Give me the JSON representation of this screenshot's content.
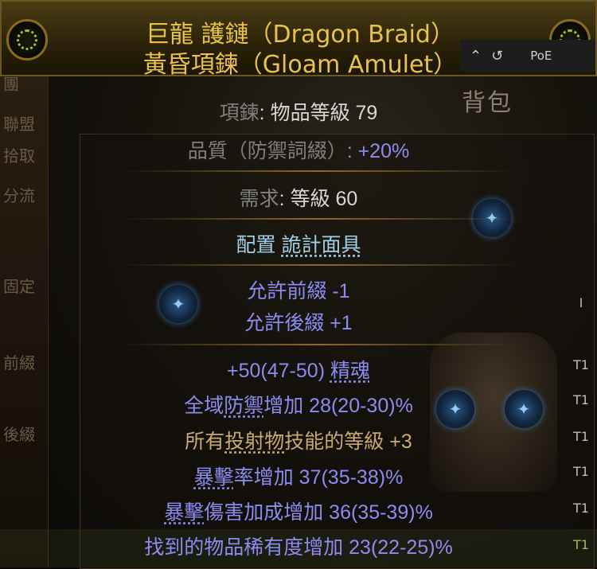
{
  "background": {
    "left_menu": [
      "團",
      "聯盟",
      "拾取",
      "分流",
      "固定",
      "前綴",
      "後綴"
    ],
    "stash_title": "背包",
    "side_labels": [
      "I",
      "T1",
      "T1",
      "T1",
      "T1",
      "T1",
      "T1"
    ]
  },
  "item": {
    "name_line1": "巨龍 護鏈（Dragon Braid）",
    "name_line2": "黃昏項鍊（Gloam Amulet）",
    "type_label": "項鍊",
    "item_level": ": 物品等級 79",
    "quality_label": "品質（防禦詞綴）",
    "quality_value": ": +20%",
    "req_label": "需求",
    "req_value": ": 等級 60",
    "config_label": "配置",
    "config_value": "詭計面具",
    "prefix_allowed": "允許前綴 -1",
    "suffix_allowed": "允許後綴 +1",
    "mods": [
      {
        "pre": "+50(47-50) ",
        "key": "精魂",
        "post": "",
        "color": "blue"
      },
      {
        "pre": "全域",
        "key": "防禦",
        "post": "增加 28(20-30)%",
        "color": "blue"
      },
      {
        "pre": "所有",
        "key": "投射物",
        "post": "技能的等級 +3",
        "color": "gold"
      },
      {
        "pre": "",
        "key": "暴擊",
        "post": "率增加 37(35-38)%",
        "color": "blue"
      },
      {
        "pre": "",
        "key": "暴擊",
        "post": "傷害加成增加 36(35-39)%",
        "color": "blue"
      },
      {
        "pre": "找到的物品稀有度增加 23(22-25)%",
        "key": "",
        "post": "",
        "color": "blue"
      }
    ]
  },
  "topbar": {
    "text": "PoE",
    "icon": "history-icon",
    "chev": "chevron-up-icon"
  },
  "colors": {
    "gold": "#e8c24a",
    "magic": "#8c8cf0",
    "grey": "#7f7f7f"
  }
}
